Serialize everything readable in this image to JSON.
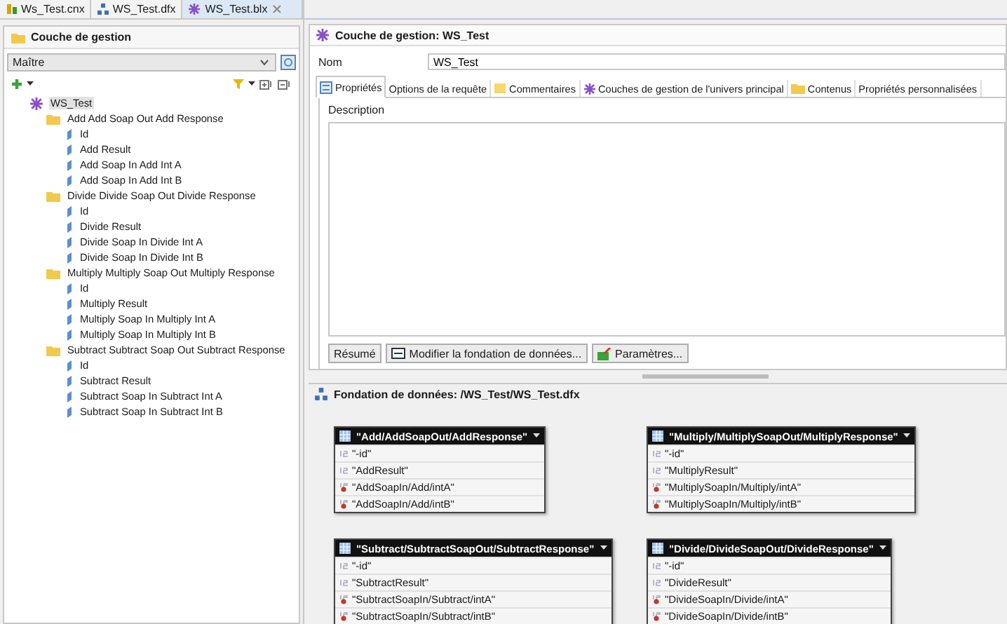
{
  "editor_tabs": [
    {
      "label": "Ws_Test.cnx",
      "selected": false
    },
    {
      "label": "WS_Test.dfx",
      "selected": false
    },
    {
      "label": "WS_Test.blx",
      "selected": true
    }
  ],
  "left_panel": {
    "title": "Couche de gestion",
    "dropdown": {
      "value": "Maître"
    },
    "tree": {
      "label": "WS_Test",
      "selected": true,
      "children": [
        {
          "label": "Add Add Soap Out Add Response",
          "children": [
            {
              "label": "Id"
            },
            {
              "label": "Add Result"
            },
            {
              "label": "Add Soap In Add Int A"
            },
            {
              "label": "Add Soap In Add Int B"
            }
          ]
        },
        {
          "label": "Divide Divide Soap Out Divide Response",
          "children": [
            {
              "label": "Id"
            },
            {
              "label": "Divide Result"
            },
            {
              "label": "Divide Soap In Divide Int A"
            },
            {
              "label": "Divide Soap In Divide Int B"
            }
          ]
        },
        {
          "label": "Multiply Multiply Soap Out Multiply Response",
          "children": [
            {
              "label": "Id"
            },
            {
              "label": "Multiply Result"
            },
            {
              "label": "Multiply Soap In Multiply Int A"
            },
            {
              "label": "Multiply Soap In Multiply Int B"
            }
          ]
        },
        {
          "label": "Subtract Subtract Soap Out Subtract Response",
          "children": [
            {
              "label": "Id"
            },
            {
              "label": "Subtract Result"
            },
            {
              "label": "Subtract Soap In Subtract Int A"
            },
            {
              "label": "Subtract Soap In Subtract Int B"
            }
          ]
        }
      ]
    }
  },
  "editor": {
    "title": "Couche de gestion: WS_Test",
    "name_label": "Nom",
    "name_value": "WS_Test",
    "tabs": [
      {
        "label": "Propriétés",
        "selected": true
      },
      {
        "label": "Options de la requête",
        "selected": false
      },
      {
        "label": "Commentaires",
        "selected": false
      },
      {
        "label": "Couches de gestion de l'univers principal",
        "selected": false
      },
      {
        "label": "Contenus",
        "selected": false
      },
      {
        "label": "Propriétés personnalisées",
        "selected": false
      }
    ],
    "description_label": "Description",
    "buttons": [
      "Résumé",
      "Modifier la fondation de données...",
      "Paramètres..."
    ]
  },
  "data_foundation": {
    "title": "Fondation de données: /WS_Test/WS_Test.dfx",
    "tables": [
      {
        "name": "\"Add/AddSoapOut/AddResponse\"",
        "columns": [
          {
            "name": "\"-id\"",
            "kind": "number"
          },
          {
            "name": "\"AddResult\"",
            "kind": "number"
          },
          {
            "name": "\"AddSoapIn/Add/intA\"",
            "kind": "input"
          },
          {
            "name": "\"AddSoapIn/Add/intB\"",
            "kind": "input"
          }
        ]
      },
      {
        "name": "\"Multiply/MultiplySoapOut/MultiplyResponse\"",
        "columns": [
          {
            "name": "\"-id\"",
            "kind": "number"
          },
          {
            "name": "\"MultiplyResult\"",
            "kind": "number"
          },
          {
            "name": "\"MultiplySoapIn/Multiply/intA\"",
            "kind": "input"
          },
          {
            "name": "\"MultiplySoapIn/Multiply/intB\"",
            "kind": "input"
          }
        ]
      },
      {
        "name": "\"Subtract/SubtractSoapOut/SubtractResponse\"",
        "columns": [
          {
            "name": "\"-id\"",
            "kind": "number"
          },
          {
            "name": "\"SubtractResult\"",
            "kind": "number"
          },
          {
            "name": "\"SubtractSoapIn/Subtract/intA\"",
            "kind": "input"
          },
          {
            "name": "\"SubtractSoapIn/Subtract/intB\"",
            "kind": "input"
          }
        ]
      },
      {
        "name": "\"Divide/DivideSoapOut/DivideResponse\"",
        "columns": [
          {
            "name": "\"-id\"",
            "kind": "number"
          },
          {
            "name": "\"DivideResult\"",
            "kind": "number"
          },
          {
            "name": "\"DivideSoapIn/Divide/intA\"",
            "kind": "input"
          },
          {
            "name": "\"DivideSoapIn/Divide/intB\"",
            "kind": "input"
          }
        ]
      }
    ]
  }
}
